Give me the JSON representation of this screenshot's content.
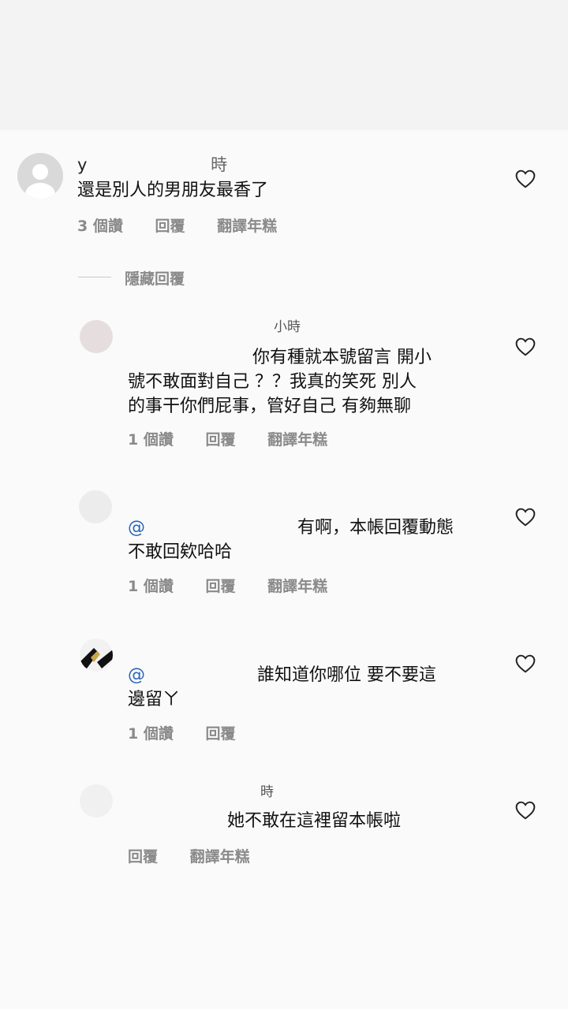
{
  "comments": [
    {
      "username": "y",
      "time": "時",
      "text_lines": [
        "還是別人的男朋友最香了"
      ],
      "likes": "3 個讚",
      "reply": "回覆",
      "translate": "翻譯年糕"
    }
  ],
  "hide_replies": "隱藏回覆",
  "replies": [
    {
      "username": "",
      "time": "小時",
      "mention": "",
      "text_lines": [
        "你有種就本號留言 開小",
        "號不敢面對自己 ？？我真的笑死 別人",
        "的事干你們屁事，管好自己 有夠無聊"
      ],
      "likes": "1 個讚",
      "reply": "回覆",
      "translate": "翻譯年糕"
    },
    {
      "username": "",
      "time": "",
      "mention": "@",
      "text_lines": [
        "有啊，本帳回覆動態",
        "不敢回欸哈哈"
      ],
      "likes": "1 個讚",
      "reply": "回覆",
      "translate": "翻譯年糕"
    },
    {
      "username": "",
      "time": "",
      "mention": "@",
      "text_lines": [
        "誰知道你哪位 要不要這",
        "邊留ㄚ"
      ],
      "likes": "1 個讚",
      "reply": "回覆",
      "translate": ""
    },
    {
      "username": "",
      "time": "時",
      "mention": "",
      "text_lines": [
        "她不敢在這裡留本帳啦"
      ],
      "likes": "",
      "reply": "回覆",
      "translate": "翻譯年糕"
    }
  ],
  "icons": {
    "heart": "heart-icon",
    "avatar": "avatar"
  }
}
